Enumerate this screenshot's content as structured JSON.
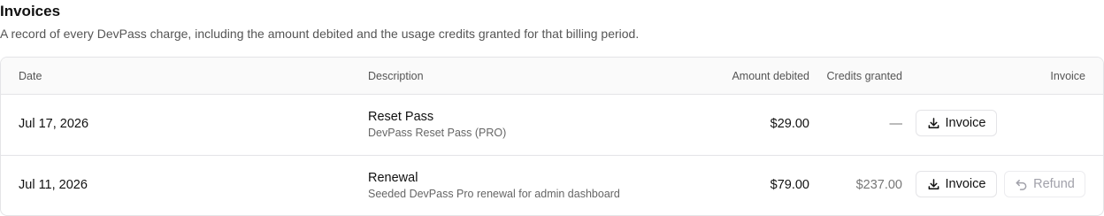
{
  "header": {
    "title": "Invoices",
    "description": "A record of every DevPass charge, including the amount debited and the usage credits granted for that billing period."
  },
  "table": {
    "columns": {
      "date": "Date",
      "description": "Description",
      "amount": "Amount debited",
      "credits": "Credits granted",
      "invoice": "Invoice"
    },
    "rows": [
      {
        "date": "Jul 17, 2026",
        "title": "Reset Pass",
        "subtitle": "DevPass Reset Pass (PRO)",
        "amount": "$29.00",
        "credits": "—",
        "invoice_label": "Invoice"
      },
      {
        "date": "Jul 11, 2026",
        "title": "Renewal",
        "subtitle": "Seeded DevPass Pro renewal for admin dashboard",
        "amount": "$79.00",
        "credits": "$237.00",
        "invoice_label": "Invoice",
        "refund_label": "Refund"
      }
    ]
  },
  "icons": {
    "invoice": "download-icon",
    "refund": "undo-icon"
  }
}
